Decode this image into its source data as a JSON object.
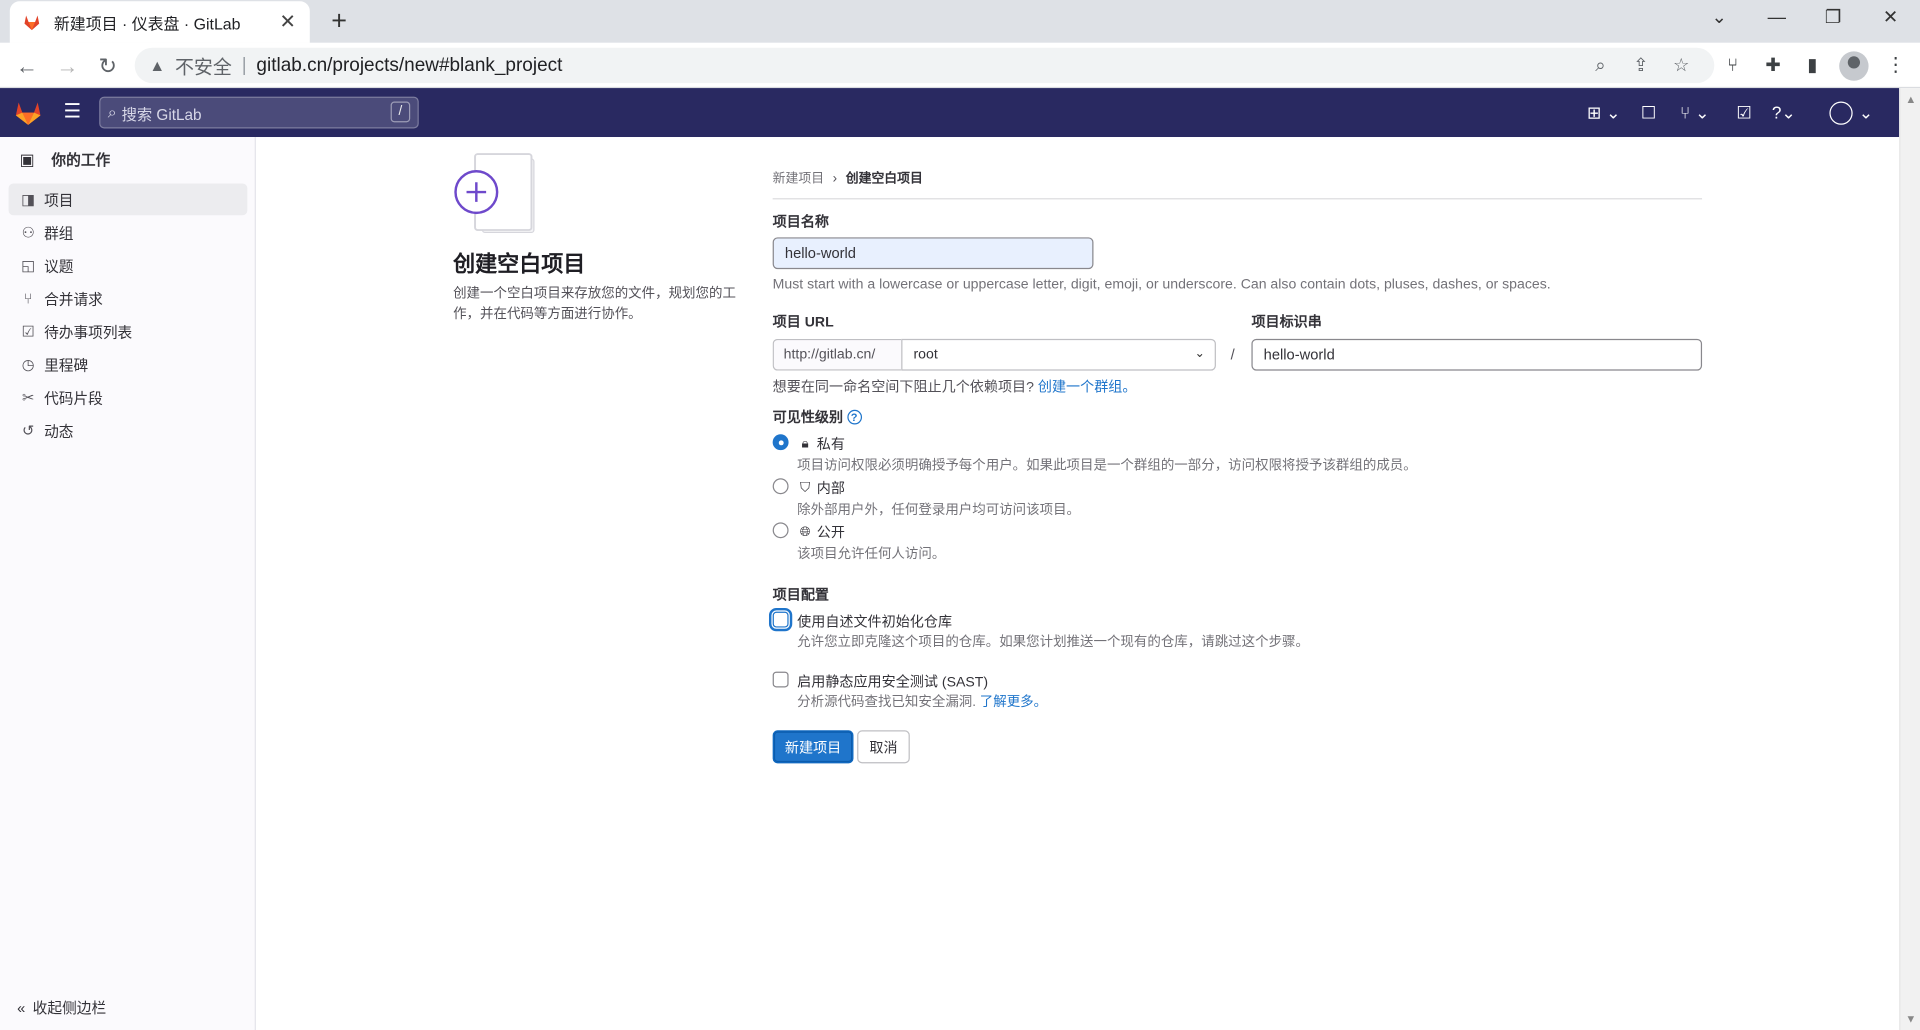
{
  "browser": {
    "tab_title": "新建项目 · 仪表盘 · GitLab",
    "tab_close": "✕",
    "new_tab": "+",
    "security_label": "不安全",
    "url": "gitlab.cn/projects/new#blank_project",
    "window_controls": [
      "minimize",
      "restore",
      "close"
    ]
  },
  "topbar": {
    "search_placeholder": "搜索 GitLab",
    "search_shortcut": "/"
  },
  "sidebar": {
    "heading": "你的工作",
    "items": [
      {
        "label": "项目",
        "icon": "project-icon",
        "active": true
      },
      {
        "label": "群组",
        "icon": "group-icon",
        "active": false
      },
      {
        "label": "议题",
        "icon": "issues-icon",
        "active": false
      },
      {
        "label": "合并请求",
        "icon": "merge-request-icon",
        "active": false
      },
      {
        "label": "待办事项列表",
        "icon": "todo-icon",
        "active": false
      },
      {
        "label": "里程碑",
        "icon": "milestone-icon",
        "active": false
      },
      {
        "label": "代码片段",
        "icon": "snippet-icon",
        "active": false
      },
      {
        "label": "动态",
        "icon": "activity-icon",
        "active": false
      }
    ],
    "collapse_label": "收起侧边栏"
  },
  "intro": {
    "title": "创建空白项目",
    "description": "创建一个空白项目来存放您的文件，规划您的工作，并在代码等方面进行协作。"
  },
  "breadcrumb": {
    "parent": "新建项目",
    "current": "创建空白项目"
  },
  "form": {
    "name_label": "项目名称",
    "name_value": "hello-world",
    "name_help": "Must start with a lowercase or uppercase letter, digit, emoji, or underscore. Can also contain dots, pluses, dashes, or spaces.",
    "url_label": "项目 URL",
    "url_prefix": "http://gitlab.cn/",
    "namespace_value": "root",
    "url_separator": "/",
    "slug_label": "项目标识串",
    "slug_value": "hello-world",
    "group_hint": "想要在同一命名空间下阻止几个依赖项目?",
    "group_hint_link": "创建一个群组",
    "group_hint_end": "。",
    "visibility_label": "可见性级别",
    "visibility_options": [
      {
        "label": "私有",
        "icon": "lock-icon",
        "desc": "项目访问权限必须明确授予每个用户。如果此项目是一个群组的一部分，访问权限将授予该群组的成员。",
        "selected": true
      },
      {
        "label": "内部",
        "icon": "shield-icon",
        "desc": "除外部用户外，任何登录用户均可访问该项目。",
        "selected": false
      },
      {
        "label": "公开",
        "icon": "globe-icon",
        "desc": "该项目允许任何人访问。",
        "selected": false
      }
    ],
    "config_label": "项目配置",
    "readme_label": "使用自述文件初始化仓库",
    "readme_desc": "允许您立即克隆这个项目的仓库。如果您计划推送一个现有的仓库，请跳过这个步骤。",
    "readme_checked": false,
    "sast_label": "启用静态应用安全测试 (SAST)",
    "sast_desc": "分析源代码查找已知安全漏洞.",
    "sast_link": "了解更多",
    "sast_end": "。",
    "sast_checked": false,
    "submit_label": "新建项目",
    "cancel_label": "取消"
  },
  "colors": {
    "topbar": "#292961",
    "primary": "#1f75cb",
    "sidebar_bg": "#fbfafd",
    "tanuki": "#fc6d26"
  }
}
